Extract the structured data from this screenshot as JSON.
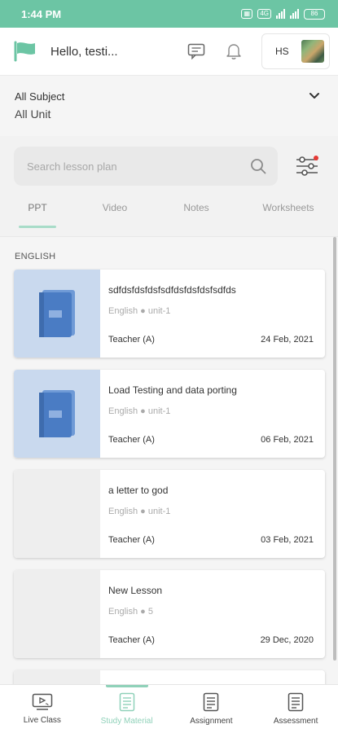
{
  "status_bar": {
    "time": "1:44 PM",
    "network": "4G",
    "battery": "86"
  },
  "header": {
    "greeting": "Hello, testi...",
    "initials": "HS"
  },
  "filters": {
    "subject": "All Subject",
    "unit": "All Unit"
  },
  "search": {
    "placeholder": "Search lesson plan"
  },
  "tabs": [
    {
      "label": "PPT",
      "active": true
    },
    {
      "label": "Video",
      "active": false
    },
    {
      "label": "Notes",
      "active": false
    },
    {
      "label": "Worksheets",
      "active": false
    }
  ],
  "section_label": "ENGLISH",
  "lessons": [
    {
      "title": "sdfdsfdsfdsfsdfdsfdsfdsfsdfds",
      "meta": "English ● unit-1",
      "teacher": "Teacher (A)",
      "date": "24 Feb, 2021",
      "thumb": "book-icon"
    },
    {
      "title": "Load Testing and data porting",
      "meta": "English ● unit-1",
      "teacher": "Teacher (A)",
      "date": "06 Feb, 2021",
      "thumb": "book-icon"
    },
    {
      "title": "a letter to god",
      "meta": "English ● unit-1",
      "teacher": "Teacher (A)",
      "date": "03 Feb, 2021",
      "thumb": "none"
    },
    {
      "title": "New Lesson",
      "meta": "English ● 5",
      "teacher": "Teacher (A)",
      "date": "29 Dec, 2020",
      "thumb": "none"
    }
  ],
  "bottom_nav": [
    {
      "label": "Live Class",
      "icon": "live-class-icon",
      "active": false
    },
    {
      "label": "Study Material",
      "icon": "study-material-icon",
      "active": true
    },
    {
      "label": "Assignment",
      "icon": "assignment-icon",
      "active": false
    },
    {
      "label": "Assessment",
      "icon": "assessment-icon",
      "active": false
    }
  ],
  "colors": {
    "brand": "#6cc5a4",
    "accent_light": "#8fd1b9",
    "thumb_blue": "#c9d9ee",
    "book_blue": "#4a7cc4",
    "notification_dot": "#e53935"
  }
}
